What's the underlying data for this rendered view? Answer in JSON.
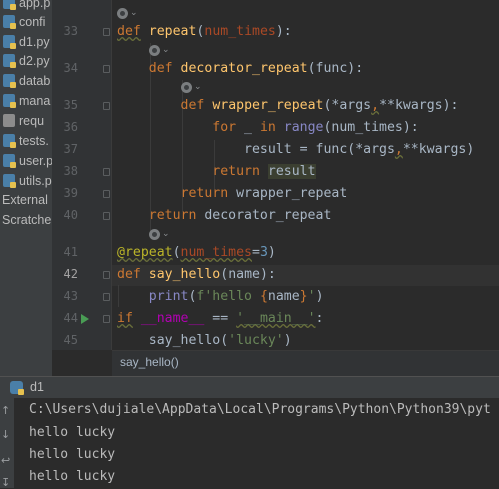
{
  "project_tree": {
    "items": [
      {
        "label": "app.p",
        "icon": "python-file-icon"
      },
      {
        "label": "confi",
        "icon": "python-file-icon"
      },
      {
        "label": "d1.py",
        "icon": "python-file-icon"
      },
      {
        "label": "d2.py",
        "icon": "python-file-icon"
      },
      {
        "label": "datab",
        "icon": "python-file-icon"
      },
      {
        "label": "mana",
        "icon": "python-file-icon"
      },
      {
        "label": "requ",
        "icon": "text-file-icon"
      },
      {
        "label": "tests.",
        "icon": "python-file-icon"
      },
      {
        "label": "user.p",
        "icon": "python-file-icon"
      },
      {
        "label": "utils.p",
        "icon": "python-file-icon"
      }
    ],
    "external": "External",
    "scratches": "Scratche"
  },
  "editor": {
    "line_numbers": [
      "33",
      "34",
      "35",
      "36",
      "37",
      "38",
      "39",
      "40",
      "41",
      "42",
      "43",
      "44",
      "45"
    ],
    "lines": {
      "l33": {
        "kw": "def",
        "fn": "repeat",
        "rest": "(",
        "param": "num_times",
        "end": "):"
      },
      "l34": {
        "kw": "def",
        "fn": "decorator_repeat",
        "rest": "(func):"
      },
      "l35": {
        "kw": "def",
        "fn": "wrapper_repeat",
        "rest": "(*args",
        "comma": ",",
        "rest2": "**kwargs):"
      },
      "l36": {
        "kw": "for",
        "mid": " _ ",
        "kw2": "in",
        "bi": " range",
        "rest": "(num_times):"
      },
      "l37": {
        "text": "result = func(*args",
        "comma": ",",
        "rest": "**kwargs)"
      },
      "l38": {
        "kw": "return",
        "val": "result"
      },
      "l39": {
        "kw": "return",
        "rest": " wrapper_repeat"
      },
      "l40": {
        "kw": "return",
        "rest": " decorator_repeat"
      },
      "l41": {
        "dec": "@repeat",
        "open": "(",
        "param": "num_times",
        "eq": "=",
        "num": "3",
        "close": ")"
      },
      "l42": {
        "kw": "def",
        "fn": "say_hello",
        "rest": "(name):"
      },
      "l43": {
        "print": "print",
        "open": "(",
        "fstr": "f'hello ",
        "brace_open": "{",
        "name": "name",
        "brace_close": "}",
        "end_str": "'",
        "close": ")"
      },
      "l44": {
        "kw": "if",
        "dunder": " __name__",
        "op": " == ",
        "str": "'__main__'",
        "colon": ":"
      },
      "l45": {
        "call": "say_hello(",
        "str": "'lucky'",
        "close": ")"
      }
    }
  },
  "breadcrumb": {
    "text": "say_hello()"
  },
  "run_window": {
    "tab_label": "d1",
    "output": [
      "C:\\Users\\dujiale\\AppData\\Local\\Programs\\Python\\Python39\\pyt",
      "hello lucky",
      "hello lucky",
      "hello lucky"
    ]
  },
  "colors": {
    "keyword": "#cc7832",
    "function": "#ffc66d",
    "string": "#6a8759",
    "number": "#6897bb",
    "parameter": "#aa4926",
    "builtin": "#8888c6",
    "decorator": "#bbb529"
  }
}
